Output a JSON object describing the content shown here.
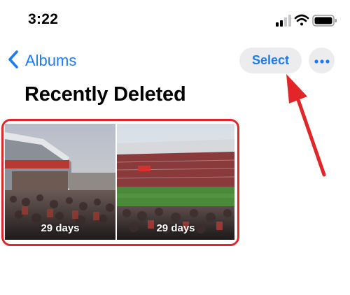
{
  "status_bar": {
    "time": "3:22"
  },
  "nav": {
    "back_label": "Albums",
    "select_label": "Select"
  },
  "page": {
    "title": "Recently Deleted"
  },
  "photos": [
    {
      "label": "29 days"
    },
    {
      "label": "29 days"
    }
  ],
  "colors": {
    "accent": "#1a7cf0",
    "highlight": "#e22526"
  }
}
